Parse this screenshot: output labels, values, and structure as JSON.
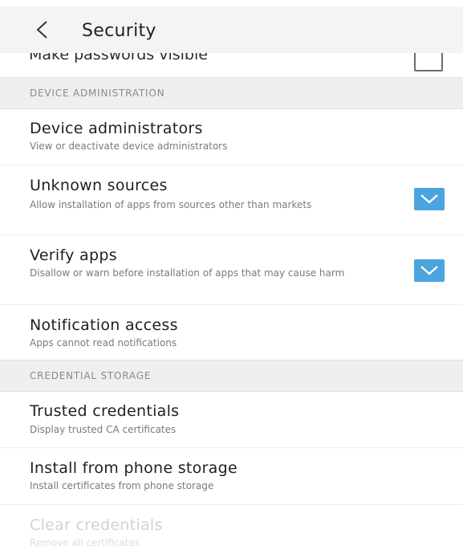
{
  "app_bar": {
    "title": "Security",
    "back_icon": "chevron-left-icon"
  },
  "cut_item": {
    "title": "Make passwords visible",
    "checked": false
  },
  "sections": {
    "device_admin": {
      "label": "DEVICE ADMINISTRATION"
    },
    "credential_storage": {
      "label": "CREDENTIAL STORAGE"
    }
  },
  "items": {
    "device_administrators": {
      "title": "Device administrators",
      "subtitle": "View or deactivate device administrators"
    },
    "unknown_sources": {
      "title": "Unknown sources",
      "subtitle": "Allow installation of apps from sources other than markets",
      "checked": true
    },
    "verify_apps": {
      "title": "Verify apps",
      "subtitle": "Disallow or warn before installation of apps that may cause harm",
      "checked": true
    },
    "notification_access": {
      "title": "Notification access",
      "subtitle": "Apps cannot read notifications"
    },
    "trusted_credentials": {
      "title": "Trusted credentials",
      "subtitle": "Display trusted CA certificates"
    },
    "install_from_storage": {
      "title": "Install from phone storage",
      "subtitle": "Install certificates from phone storage"
    },
    "clear_credentials": {
      "title": "Clear credentials",
      "subtitle": "Remove all certificates",
      "enabled": false
    }
  },
  "colors": {
    "accent": "#4aa4dd",
    "section_bg": "#efefef",
    "header_bg": "#f4f4f4"
  }
}
